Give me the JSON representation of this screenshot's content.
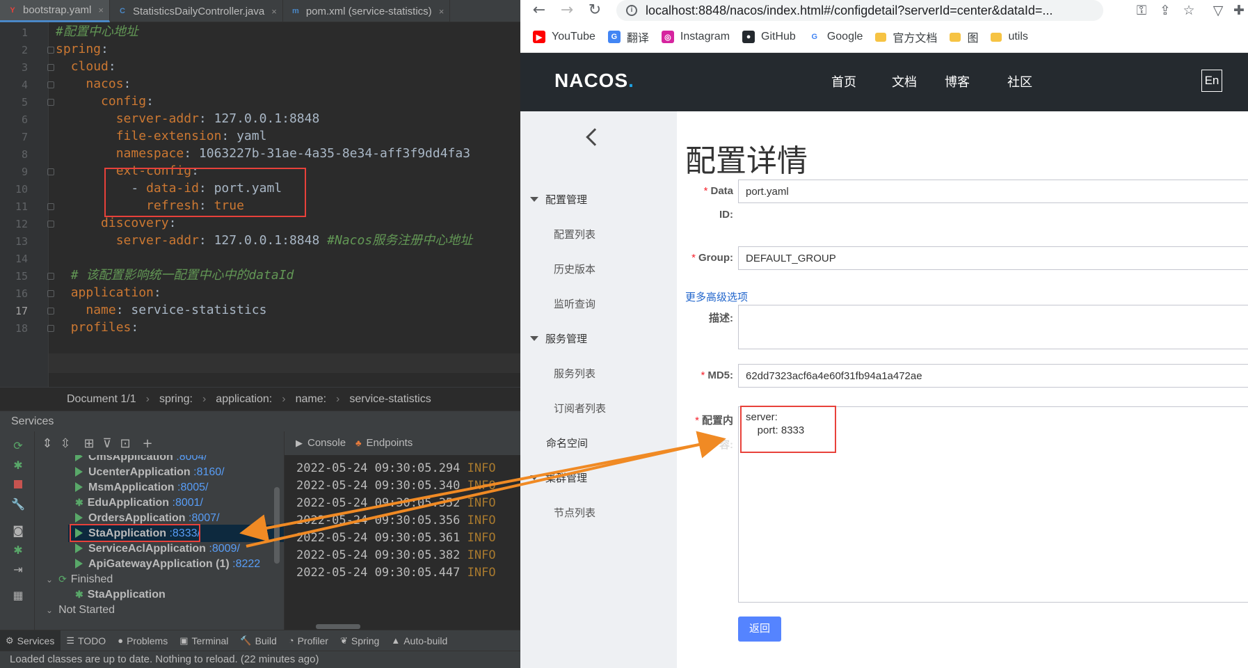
{
  "ide": {
    "tabs": [
      {
        "label": "bootstrap.yaml",
        "icon": "Y",
        "color": "#e8413a"
      },
      {
        "label": "StatisticsDailyController.java",
        "icon": "C",
        "color": "#4a88c7"
      },
      {
        "label": "pom.xml (service-statistics)",
        "icon": "m",
        "color": "#4a88c7"
      }
    ],
    "tab_close": "×",
    "line_numbers": [
      "1",
      "2",
      "3",
      "4",
      "5",
      "6",
      "7",
      "8",
      "9",
      "10",
      "11",
      "12",
      "13",
      "14",
      "15",
      "16",
      "17",
      "18"
    ],
    "code": [
      {
        "ind": "",
        "parts": [
          {
            "t": "c",
            "s": "#配置中心地址"
          }
        ]
      },
      {
        "ind": "",
        "parts": [
          {
            "t": "k",
            "s": "spring"
          },
          {
            "t": "v",
            "s": ":"
          }
        ]
      },
      {
        "ind": "  ",
        "parts": [
          {
            "t": "k",
            "s": "cloud"
          },
          {
            "t": "v",
            "s": ":"
          }
        ]
      },
      {
        "ind": "    ",
        "parts": [
          {
            "t": "k",
            "s": "nacos"
          },
          {
            "t": "v",
            "s": ":"
          }
        ]
      },
      {
        "ind": "      ",
        "parts": [
          {
            "t": "k",
            "s": "config"
          },
          {
            "t": "v",
            "s": ":"
          }
        ]
      },
      {
        "ind": "        ",
        "parts": [
          {
            "t": "k",
            "s": "server-addr"
          },
          {
            "t": "v",
            "s": ": 127.0.0.1:8848"
          }
        ]
      },
      {
        "ind": "        ",
        "parts": [
          {
            "t": "k",
            "s": "file-extension"
          },
          {
            "t": "v",
            "s": ": yaml"
          }
        ]
      },
      {
        "ind": "        ",
        "parts": [
          {
            "t": "k",
            "s": "namespace"
          },
          {
            "t": "v",
            "s": ": 1063227b-31ae-4a35-8e34-aff3f9dd4fa3"
          }
        ]
      },
      {
        "ind": "        ",
        "parts": [
          {
            "t": "k",
            "s": "ext-config"
          },
          {
            "t": "v",
            "s": ":"
          }
        ]
      },
      {
        "ind": "          ",
        "parts": [
          {
            "t": "v",
            "s": "- "
          },
          {
            "t": "k",
            "s": "data-id"
          },
          {
            "t": "v",
            "s": ": port.yaml"
          }
        ]
      },
      {
        "ind": "            ",
        "parts": [
          {
            "t": "k",
            "s": "refresh"
          },
          {
            "t": "v",
            "s": ": "
          },
          {
            "t": "k",
            "s": "true"
          }
        ]
      },
      {
        "ind": "      ",
        "parts": [
          {
            "t": "k",
            "s": "discovery"
          },
          {
            "t": "v",
            "s": ":"
          }
        ]
      },
      {
        "ind": "        ",
        "parts": [
          {
            "t": "k",
            "s": "server-addr"
          },
          {
            "t": "v",
            "s": ": 127.0.0.1:8848 "
          },
          {
            "t": "c",
            "s": "#Nacos服务注册中心地址"
          }
        ]
      },
      {
        "ind": "",
        "parts": []
      },
      {
        "ind": "  ",
        "parts": [
          {
            "t": "c",
            "s": "# 该配置影响统一配置中心中的dataId"
          }
        ]
      },
      {
        "ind": "  ",
        "parts": [
          {
            "t": "k",
            "s": "application"
          },
          {
            "t": "v",
            "s": ":"
          }
        ]
      },
      {
        "ind": "    ",
        "parts": [
          {
            "t": "k",
            "s": "name"
          },
          {
            "t": "v",
            "s": ": service-statistics"
          }
        ]
      },
      {
        "ind": "  ",
        "parts": [
          {
            "t": "k",
            "s": "profiles"
          },
          {
            "t": "v",
            "s": ":"
          }
        ]
      }
    ],
    "breadcrumb": [
      "Document 1/1",
      "spring:",
      "application:",
      "name:",
      "service-statistics"
    ],
    "breadcrumb_sep": "›",
    "services_title": "Services",
    "tree": [
      {
        "kind": "run",
        "name": "CmsApplication",
        "port": ":8004/"
      },
      {
        "kind": "run",
        "name": "UcenterApplication",
        "port": ":8160/"
      },
      {
        "kind": "run",
        "name": "MsmApplication",
        "port": ":8005/"
      },
      {
        "kind": "debug",
        "name": "EduApplication",
        "port": ":8001/"
      },
      {
        "kind": "run",
        "name": "OrdersApplication",
        "port": ":8007/"
      },
      {
        "kind": "run",
        "name": "StaApplication",
        "port": ":8333/",
        "selected": true
      },
      {
        "kind": "run",
        "name": "ServiceAclApplication",
        "port": ":8009/"
      },
      {
        "kind": "run",
        "name": "ApiGatewayApplication (1)",
        "port": ":8222"
      },
      {
        "kind": "group",
        "name": "Finished",
        "port": ""
      },
      {
        "kind": "finished",
        "name": "StaApplication",
        "port": ""
      },
      {
        "kind": "group2",
        "name": "Not Started",
        "port": ""
      }
    ],
    "console_tab": "Console",
    "endpoints_tab": "Endpoints",
    "logs": [
      {
        "time": "2022-05-24 09:30:05.294",
        "level": "INFO"
      },
      {
        "time": "2022-05-24 09:30:05.340",
        "level": "INFO"
      },
      {
        "time": "2022-05-24 09:30:05.352",
        "level": "INFO"
      },
      {
        "time": "2022-05-24 09:30:05.356",
        "level": "INFO"
      },
      {
        "time": "2022-05-24 09:30:05.361",
        "level": "INFO"
      },
      {
        "time": "2022-05-24 09:30:05.382",
        "level": "INFO"
      },
      {
        "time": "2022-05-24 09:30:05.447",
        "level": "INFO"
      }
    ],
    "bottom_tabs": [
      {
        "label": "Services",
        "icon": "⚙",
        "active": true
      },
      {
        "label": "TODO",
        "icon": "☰"
      },
      {
        "label": "Problems",
        "icon": "●"
      },
      {
        "label": "Terminal",
        "icon": "▣"
      },
      {
        "label": "Build",
        "icon": "🔨"
      },
      {
        "label": "Profiler",
        "icon": "◔"
      },
      {
        "label": "Spring",
        "icon": "❦"
      },
      {
        "label": "Auto-build",
        "icon": "▲"
      }
    ],
    "status": "Loaded classes are up to date. Nothing to reload. (22 minutes ago)"
  },
  "browser": {
    "url": "localhost:8848/nacos/index.html#/configdetail?serverId=center&dataId=...",
    "bookmarks": [
      {
        "label": "YouTube",
        "icon": "▶",
        "bg": "#ff0000"
      },
      {
        "label": "翻译",
        "icon": "G",
        "bg": "#4285f4"
      },
      {
        "label": "Instagram",
        "icon": "◎",
        "bg": "#d6249f"
      },
      {
        "label": "GitHub",
        "icon": "●",
        "bg": "#24292e"
      },
      {
        "label": "Google",
        "icon": "G",
        "bg": "#ffffff"
      },
      {
        "label": "官方文档",
        "icon": "",
        "bg": "folder"
      },
      {
        "label": "图",
        "icon": "",
        "bg": "folder"
      },
      {
        "label": "utils",
        "icon": "",
        "bg": "folder"
      }
    ],
    "logo_main": "NACOS",
    "logo_dot": ".",
    "top_nav": [
      "首页",
      "文档",
      "博客",
      "社区"
    ],
    "lang": "En",
    "side_nav": [
      {
        "type": "group",
        "label": "配置管理"
      },
      {
        "type": "item",
        "label": "配置列表"
      },
      {
        "type": "item",
        "label": "历史版本"
      },
      {
        "type": "item",
        "label": "监听查询"
      },
      {
        "type": "group",
        "label": "服务管理"
      },
      {
        "type": "item",
        "label": "服务列表"
      },
      {
        "type": "item",
        "label": "订阅者列表"
      },
      {
        "type": "plain",
        "label": "命名空间"
      },
      {
        "type": "group",
        "label": "集群管理"
      },
      {
        "type": "item",
        "label": "节点列表"
      }
    ],
    "page_title": "配置详情",
    "form": {
      "data_id_label_1": "Data",
      "data_id_label_2": "ID:",
      "data_id_value": "port.yaml",
      "group_label": "Group:",
      "group_value": "DEFAULT_GROUP",
      "more_options": "更多高级选项",
      "desc_label": "描述:",
      "desc_value": "",
      "md5_label": "MD5:",
      "md5_value": "62dd7323acf6a4e60f31fb94a1a472ae",
      "content_label_1": "配置内",
      "content_label_2": "容:",
      "content_lines": [
        "server:",
        "    port: 8333"
      ],
      "back_button": "返回"
    },
    "required_mark": "*"
  },
  "annotation_colors": {
    "box": "#e8413a",
    "arrow": "#f08a24"
  }
}
